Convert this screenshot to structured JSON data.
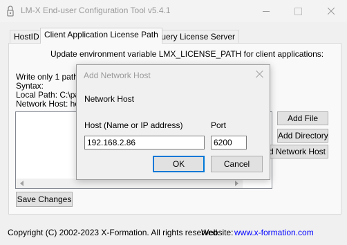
{
  "window": {
    "title": "LM-X End-user Configuration Tool v5.4.1",
    "controls": [
      "minimize",
      "maximize",
      "close"
    ]
  },
  "tabs": [
    {
      "label": "HostID",
      "active": false
    },
    {
      "label": "Client Application License Path",
      "active": true
    },
    {
      "label": "Query License Server",
      "active": false
    }
  ],
  "panel": {
    "header": "Update environment variable LMX_LICENSE_PATH for client applications:",
    "instructions": [
      "Write only 1 path pe",
      "Syntax:",
      "Local Path: C:\\pat",
      "Network Host: hos"
    ],
    "buttons": {
      "add_file": "Add File",
      "add_directory": "Add Directory",
      "add_network_host": "dd Network Host"
    },
    "save_changes": "Save Changes"
  },
  "footer": {
    "copyright": "Copyright (C) 2002-2023 X-Formation. All rights reserved.",
    "website_label": "Website:",
    "website_link": "www.x-formation.com"
  },
  "dialog": {
    "title": "Add Network Host",
    "section_label": "Network Host",
    "host_label": "Host (Name or IP address)",
    "host_value": "192.168.2.86",
    "port_label": "Port",
    "port_value": "6200",
    "ok_label": "OK",
    "cancel_label": "Cancel"
  },
  "colors": {
    "accent": "#0078d7",
    "link": "#0000ff",
    "window_bg": "#f0f0f0"
  }
}
